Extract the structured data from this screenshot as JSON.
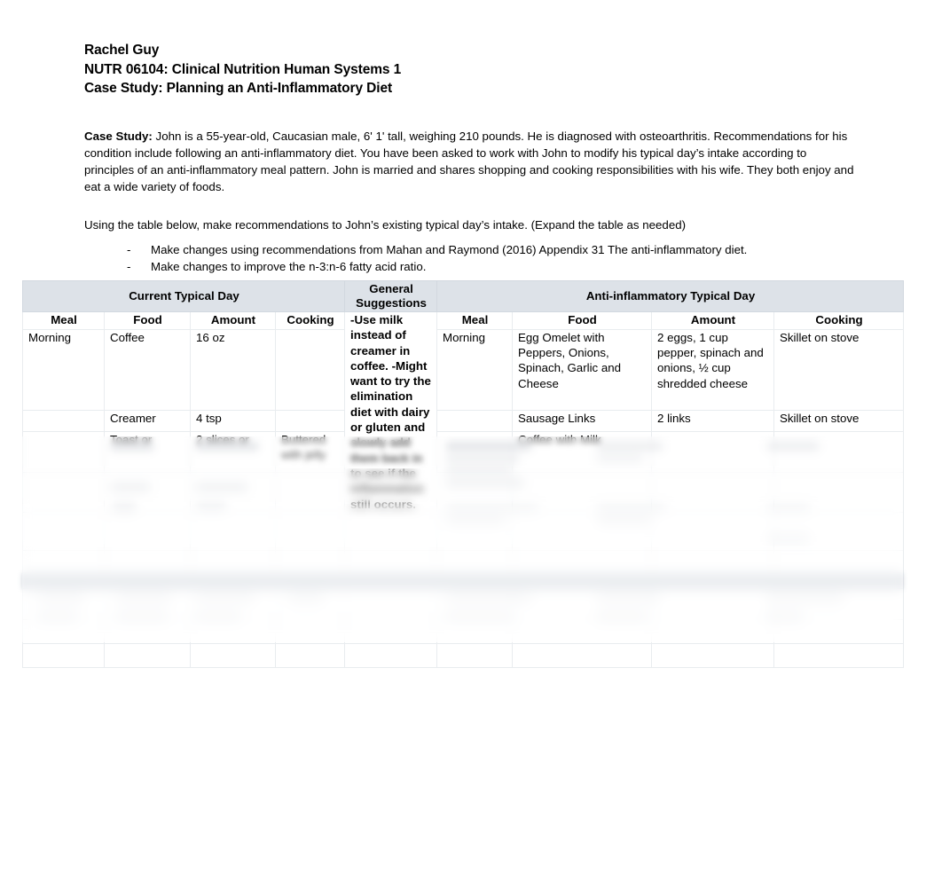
{
  "document": {
    "author": "Rachel Guy",
    "course": "NUTR 06104: Clinical Nutrition Human Systems 1",
    "assignment_title": "Case Study: Planning an Anti-Inflammatory Diet"
  },
  "case_study": {
    "label": "Case Study:",
    "body": " John is a 55-year-old, Caucasian male, 6' 1' tall, weighing 210 pounds. He is diagnosed with osteoarthritis. Recommendations for his condition include following an anti-inflammatory diet. You have been asked to work with John to modify his typical day’s intake according to principles of an anti-inflammatory meal pattern. John is married and shares shopping and cooking responsibilities with his wife. They both enjoy and eat a wide variety of foods."
  },
  "instructions": {
    "intro": "Using the table below, make recommendations to John’s existing typical day’s intake. (Expand the table as needed)",
    "bullet_marker": "-",
    "bullets": [
      "Make changes using recommendations from Mahan and Raymond (2016) Appendix 31 The anti-inflammatory diet.",
      "Make changes to improve the n-3:n-6 fatty acid ratio."
    ]
  },
  "table": {
    "group_headers": {
      "current": "Current Typical Day",
      "general": "General Suggestions",
      "anti": "Anti-inflammatory Typical Day"
    },
    "column_headers": {
      "meal1": "Meal",
      "food1": "Food",
      "amount1": "Amount",
      "cooking1": "Cooking",
      "meal2": "Meal",
      "food2": "Food",
      "amount2": "Amount",
      "cooking2": "Cooking"
    },
    "general_suggestions": "-Use milk instead of creamer in coffee. -Might want to try the elimination diet with dairy or gluten and slowly add them back in to see if the inflammation still occurs.",
    "general_suggestions_lines": [
      "-Use milk instead of creamer in coffee.",
      "-Might want to try the elimination diet with dairy or gluten and slowly add them back in to see if the inflammation still occurs."
    ],
    "rows": [
      {
        "meal1": "Morning",
        "food1": "Coffee",
        "amount1": "16 oz",
        "cooking1": "",
        "meal2": "Morning",
        "food2": "Egg Omelet with Peppers, Onions, Spinach, Garlic and Cheese",
        "amount2": "2 eggs, 1 cup pepper, spinach and onions, ½ cup shredded cheese",
        "cooking2": "Skillet on stove"
      },
      {
        "meal1": "",
        "food1": "Creamer",
        "amount1": "4 tsp",
        "cooking1": "",
        "meal2": "",
        "food2": "Sausage Links",
        "amount2": "2 links",
        "cooking2": "Skillet on stove"
      },
      {
        "meal1": "",
        "food1": "Toast or",
        "amount1": "2 slices or",
        "cooking1": "Buttered with jelly",
        "meal2": "",
        "food2": "Coffee with Milk",
        "amount2": "",
        "cooking2": ""
      }
    ]
  }
}
